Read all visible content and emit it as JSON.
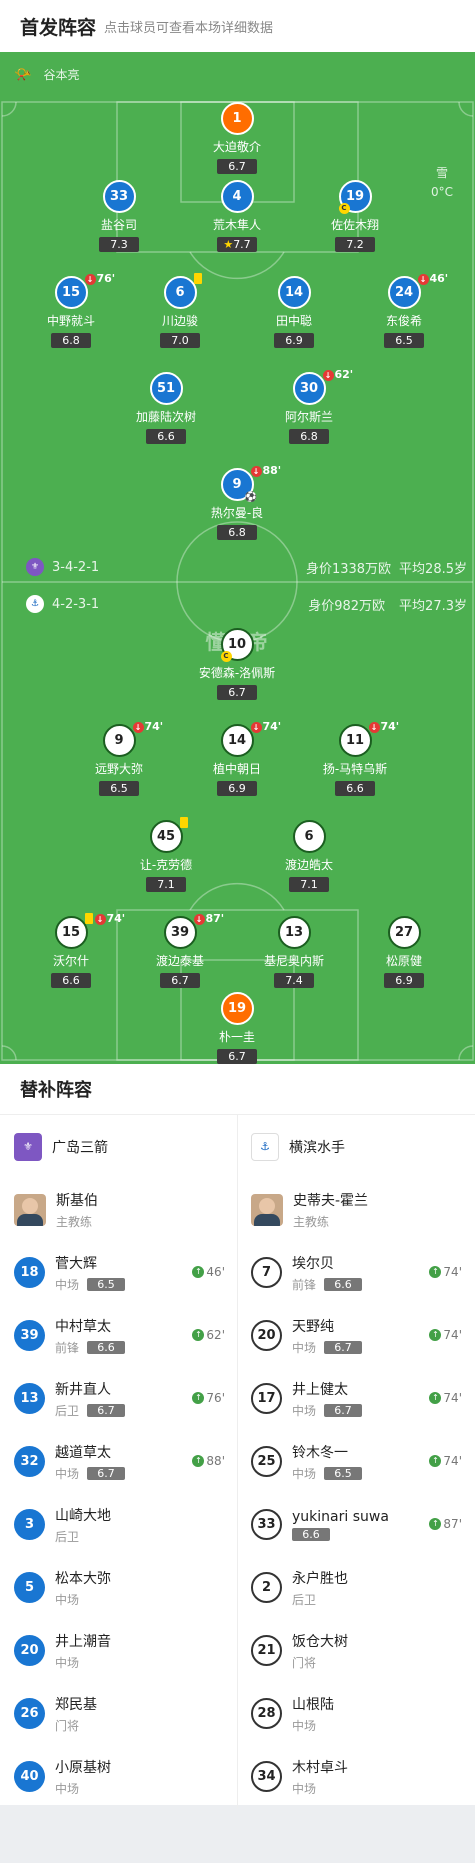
{
  "header": {
    "title": "首发阵容",
    "subtitle": "点击球员可查看本场详细数据"
  },
  "referee": {
    "icon": "whistle-icon",
    "name": "谷本亮"
  },
  "weather": {
    "condition": "雪",
    "temp": "0°C"
  },
  "home": {
    "formation": "3-4-2-1",
    "value": "身价1338万欧",
    "age": "平均28.5岁",
    "color": "#1976d2"
  },
  "away": {
    "formation": "4-2-3-1",
    "value": "身价982万欧",
    "age": "平均27.3岁"
  },
  "watermark": "懂球帝",
  "home_players": [
    {
      "no": "1",
      "name": "大迫敬介",
      "rating": "6.7"
    },
    {
      "no": "33",
      "name": "盐谷司",
      "rating": "7.3"
    },
    {
      "no": "4",
      "name": "荒木隼人",
      "rating": "7.7"
    },
    {
      "no": "19",
      "name": "佐佐木翔",
      "rating": "7.2"
    },
    {
      "no": "15",
      "name": "中野就斗",
      "rating": "6.8",
      "sub": "76'"
    },
    {
      "no": "6",
      "name": "川边骏",
      "rating": "7.0"
    },
    {
      "no": "14",
      "name": "田中聪",
      "rating": "6.9"
    },
    {
      "no": "24",
      "name": "东俊希",
      "rating": "6.5",
      "sub": "46'"
    },
    {
      "no": "51",
      "name": "加藤陆次树",
      "rating": "6.6"
    },
    {
      "no": "30",
      "name": "阿尔斯兰",
      "rating": "6.8",
      "sub": "62'"
    },
    {
      "no": "9",
      "name": "热尔曼-良",
      "rating": "6.8",
      "sub": "88'"
    }
  ],
  "away_players": [
    {
      "no": "10",
      "name": "安德森-洛佩斯",
      "rating": "6.7"
    },
    {
      "no": "9",
      "name": "远野大弥",
      "rating": "6.5",
      "sub": "74'"
    },
    {
      "no": "14",
      "name": "植中朝日",
      "rating": "6.9",
      "sub": "74'"
    },
    {
      "no": "11",
      "name": "扬-马特乌斯",
      "rating": "6.6",
      "sub": "74'"
    },
    {
      "no": "45",
      "name": "让-克劳德",
      "rating": "7.1"
    },
    {
      "no": "6",
      "name": "渡边皓太",
      "rating": "7.1"
    },
    {
      "no": "15",
      "name": "沃尔什",
      "rating": "6.6",
      "sub": "74'"
    },
    {
      "no": "39",
      "name": "渡边泰基",
      "rating": "6.7",
      "sub": "87'"
    },
    {
      "no": "13",
      "name": "基尼奥内斯",
      "rating": "7.4"
    },
    {
      "no": "27",
      "name": "松原健",
      "rating": "6.9"
    },
    {
      "no": "19",
      "name": "朴一圭",
      "rating": "6.7"
    }
  ],
  "subs_title": "替补阵容",
  "home_team": {
    "name": "广岛三箭",
    "coach": "斯基伯",
    "coach_role": "主教练"
  },
  "away_team": {
    "name": "横滨水手",
    "coach": "史蒂夫-霍兰",
    "coach_role": "主教练"
  },
  "home_subs": [
    {
      "no": "18",
      "name": "菅大辉",
      "pos": "中场",
      "rating": "6.5",
      "time": "46'"
    },
    {
      "no": "39",
      "name": "中村草太",
      "pos": "前锋",
      "rating": "6.6",
      "time": "62'"
    },
    {
      "no": "13",
      "name": "新井直人",
      "pos": "后卫",
      "rating": "6.7",
      "time": "76'"
    },
    {
      "no": "32",
      "name": "越道草太",
      "pos": "中场",
      "rating": "6.7",
      "time": "88'"
    },
    {
      "no": "3",
      "name": "山崎大地",
      "pos": "后卫"
    },
    {
      "no": "5",
      "name": "松本大弥",
      "pos": "中场"
    },
    {
      "no": "20",
      "name": "井上潮音",
      "pos": "中场"
    },
    {
      "no": "26",
      "name": "郑民基",
      "pos": "门将"
    },
    {
      "no": "40",
      "name": "小原基树",
      "pos": "中场"
    }
  ],
  "away_subs": [
    {
      "no": "7",
      "name": "埃尔贝",
      "pos": "前锋",
      "rating": "6.6",
      "time": "74'"
    },
    {
      "no": "20",
      "name": "天野纯",
      "pos": "中场",
      "rating": "6.7",
      "time": "74'"
    },
    {
      "no": "17",
      "name": "井上健太",
      "pos": "中场",
      "rating": "6.7",
      "time": "74'"
    },
    {
      "no": "25",
      "name": "铃木冬一",
      "pos": "中场",
      "rating": "6.5",
      "time": "74'"
    },
    {
      "no": "33",
      "name": "yukinari suwa",
      "pos": "",
      "rating": "6.6",
      "time": "87'"
    },
    {
      "no": "2",
      "name": "永户胜也",
      "pos": "后卫"
    },
    {
      "no": "21",
      "name": "饭仓大树",
      "pos": "门将"
    },
    {
      "no": "28",
      "name": "山根陆",
      "pos": "中场"
    },
    {
      "no": "34",
      "name": "木村卓斗",
      "pos": "中场"
    }
  ]
}
